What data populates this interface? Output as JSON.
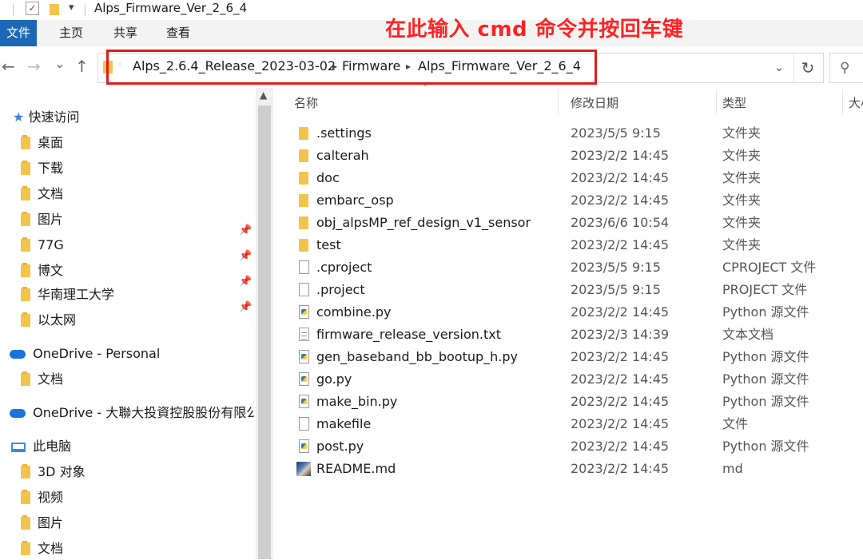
{
  "window": {
    "title": "Alps_Firmware_Ver_2_6_4",
    "qa_check": "✓",
    "qa_dropdown": "▾"
  },
  "ribbon": {
    "tabs": [
      "文件",
      "主页",
      "共享",
      "查看"
    ]
  },
  "annotation": {
    "text": "在此输入 cmd 命令并按回车键",
    "color": "#ff2222"
  },
  "nav": {
    "back": "←",
    "forward": "→",
    "recent": "⌄",
    "up": "↑",
    "breadcrumb": [
      "Alps_2.6.4_Release_2023-03-02",
      "Firmware",
      "Alps_Firmware_Ver_2_6_4"
    ],
    "crumb_sep": "▸",
    "dropdown": "⌄",
    "refresh": "↻",
    "search_glyph": "⚲"
  },
  "sidebar": {
    "quick_access": "快速访问",
    "quick_items": [
      {
        "label": "桌面",
        "pinned": true
      },
      {
        "label": "下载",
        "pinned": true
      },
      {
        "label": "文档",
        "pinned": true
      },
      {
        "label": "图片",
        "pinned": true
      },
      {
        "label": "77G",
        "pinned": false
      },
      {
        "label": "博文",
        "pinned": false
      },
      {
        "label": "华南理工大学",
        "pinned": false
      },
      {
        "label": "以太网",
        "pinned": false
      }
    ],
    "pin_glyph": "📌",
    "onedrive_personal": "OneDrive - Personal",
    "onedrive_personal_items": [
      "文档"
    ],
    "onedrive_org": "OneDrive - 大聯大投資控股股份有限公司",
    "this_pc": "此电脑",
    "pc_items": [
      "3D 对象",
      "视频",
      "图片",
      "文档"
    ]
  },
  "columns": {
    "name": "名称",
    "date": "修改日期",
    "type": "类型",
    "size": "大小"
  },
  "files": [
    {
      "name": ".settings",
      "date": "2023/5/5 9:15",
      "type": "文件夹",
      "icon": "folder"
    },
    {
      "name": "calterah",
      "date": "2023/2/2 14:45",
      "type": "文件夹",
      "icon": "folder"
    },
    {
      "name": "doc",
      "date": "2023/2/2 14:45",
      "type": "文件夹",
      "icon": "folder"
    },
    {
      "name": "embarc_osp",
      "date": "2023/2/2 14:45",
      "type": "文件夹",
      "icon": "folder"
    },
    {
      "name": "obj_alpsMP_ref_design_v1_sensor",
      "date": "2023/6/6 10:54",
      "type": "文件夹",
      "icon": "folder"
    },
    {
      "name": "test",
      "date": "2023/2/2 14:45",
      "type": "文件夹",
      "icon": "folder"
    },
    {
      "name": ".cproject",
      "date": "2023/5/5 9:15",
      "type": "CPROJECT 文件",
      "icon": "file"
    },
    {
      "name": ".project",
      "date": "2023/5/5 9:15",
      "type": "PROJECT 文件",
      "icon": "file"
    },
    {
      "name": "combine.py",
      "date": "2023/2/2 14:45",
      "type": "Python 源文件",
      "icon": "python"
    },
    {
      "name": "firmware_release_version.txt",
      "date": "2023/2/3 14:39",
      "type": "文本文档",
      "icon": "text"
    },
    {
      "name": "gen_baseband_bb_bootup_h.py",
      "date": "2023/2/2 14:45",
      "type": "Python 源文件",
      "icon": "python"
    },
    {
      "name": "go.py",
      "date": "2023/2/2 14:45",
      "type": "Python 源文件",
      "icon": "python"
    },
    {
      "name": "make_bin.py",
      "date": "2023/2/2 14:45",
      "type": "Python 源文件",
      "icon": "python"
    },
    {
      "name": "makefile",
      "date": "2023/2/2 14:45",
      "type": "文件",
      "icon": "file"
    },
    {
      "name": "post.py",
      "date": "2023/2/2 14:45",
      "type": "Python 源文件",
      "icon": "python"
    },
    {
      "name": "README.md",
      "date": "2023/2/2 14:45",
      "type": "md",
      "icon": "markdown"
    }
  ]
}
